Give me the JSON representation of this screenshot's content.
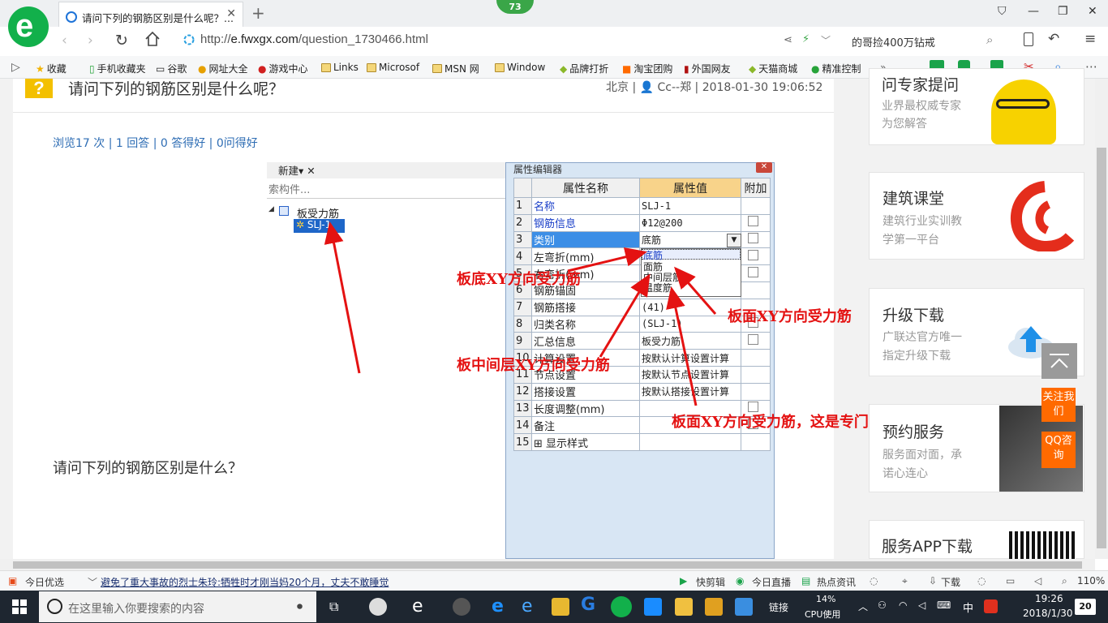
{
  "browser": {
    "badge_count": "73",
    "tab_title": "请问下列的钢筋区别是什么呢？...",
    "url_prefix": "http://",
    "url_domain": "e.fwxgx.com",
    "url_path": "/question_1730466.html",
    "search_text": "的哥捡400万钻戒",
    "bookmarks": [
      "收藏",
      "手机收藏夹",
      "谷歌",
      "网址大全",
      "游戏中心",
      "Links",
      "Microsof",
      "MSN 网",
      "Window",
      "品牌打折",
      "淘宝团购",
      "外国网友",
      "天猫商城",
      "精准控制"
    ]
  },
  "question": {
    "title": "请问下列的钢筋区别是什么呢？",
    "meta": "北京 | 👤 Cc--郑 | 2018-01-30 19:06:52",
    "stats": "浏览17 次 | 1 回答 | 0 答得好 | 0问得好",
    "body": "请问下列的钢筋区别是什么？"
  },
  "screenshot": {
    "toolbar_new": "新建▾  ✕  ",
    "tree_search": "索构件...",
    "tree_root": "板受力筋",
    "tree_child": "SLJ-1",
    "prop_caption": "属性编辑器",
    "col_name": "属性名称",
    "col_value": "属性值",
    "col_extra": "附加",
    "rows": [
      {
        "n": "1",
        "name": "名称",
        "value": "SLJ-1",
        "blue": true,
        "cb": false
      },
      {
        "n": "2",
        "name": "钢筋信息",
        "value": "Φ12@200",
        "blue": true,
        "cb": true
      },
      {
        "n": "3",
        "name": "类别",
        "value": "底筋",
        "blue": false,
        "cb": true
      },
      {
        "n": "4",
        "name": "左弯折(mm)",
        "value": "",
        "blue": false,
        "cb": true
      },
      {
        "n": "5",
        "name": "右弯折(mm)",
        "value": "",
        "blue": false,
        "cb": true
      },
      {
        "n": "6",
        "name": "钢筋锚固",
        "value": "",
        "blue": false,
        "cb": false
      },
      {
        "n": "7",
        "name": "钢筋搭接",
        "value": "(41)",
        "blue": false,
        "cb": false
      },
      {
        "n": "8",
        "name": "归类名称",
        "value": "(SLJ-1)",
        "blue": false,
        "cb": true
      },
      {
        "n": "9",
        "name": "汇总信息",
        "value": "板受力筋",
        "blue": false,
        "cb": true
      },
      {
        "n": "10",
        "name": "计算设置",
        "value": "按默认计算设置计算",
        "blue": false,
        "cb": false
      },
      {
        "n": "11",
        "name": "节点设置",
        "value": "按默认节点设置计算",
        "blue": false,
        "cb": false
      },
      {
        "n": "12",
        "name": "搭接设置",
        "value": "按默认搭接设置计算",
        "blue": false,
        "cb": false
      },
      {
        "n": "13",
        "name": "长度调整(mm)",
        "value": "",
        "blue": false,
        "cb": true
      },
      {
        "n": "14",
        "name": "备注",
        "value": "",
        "blue": false,
        "cb": true
      },
      {
        "n": "15",
        "name": "⊞ 显示样式",
        "value": "",
        "blue": false,
        "cb": false
      }
    ],
    "dropdown": [
      "底筋",
      "面筋",
      "中间层筋",
      "温度筋"
    ],
    "annotations": {
      "a1": "板底XY方向受力筋",
      "a2": "板面XY方向受力筋",
      "a3": "板中间层XY方向受力筋",
      "a4": "板面XY方向受力筋，这是专门定义温度钢筋"
    }
  },
  "sidebar": {
    "expert": {
      "title": "问专家提问",
      "sub1": "业界最权威专家",
      "sub2": "为您解答"
    },
    "course": {
      "title": "建筑课堂",
      "sub1": "建筑行业实训教",
      "sub2": "学第一平台"
    },
    "upgrade": {
      "title": "升级下载",
      "sub1": "广联达官方唯一",
      "sub2": "指定升级下载"
    },
    "service": {
      "title": "预约服务",
      "sub1": "服务面对面，承",
      "sub2": "诺心连心"
    },
    "app": {
      "title": "服务APP下载"
    },
    "follow": "关注我们",
    "qq": "QQ咨询"
  },
  "statusbar": {
    "left": "今日优选",
    "news": "避免了重大事故的烈士朱玲:牺牲时才刚当妈20个月，丈夫不敢睡觉",
    "items": [
      "快剪辑",
      "今日直播",
      "热点资讯"
    ],
    "download": "下载",
    "zoom": "110%"
  },
  "taskbar": {
    "search_placeholder": "在这里输入你要搜索的内容",
    "links": "链接",
    "cpu_pct": "14%",
    "cpu_label": "CPU使用",
    "ime": "中",
    "time": "19:26",
    "date": "2018/1/30",
    "notif": "20"
  }
}
